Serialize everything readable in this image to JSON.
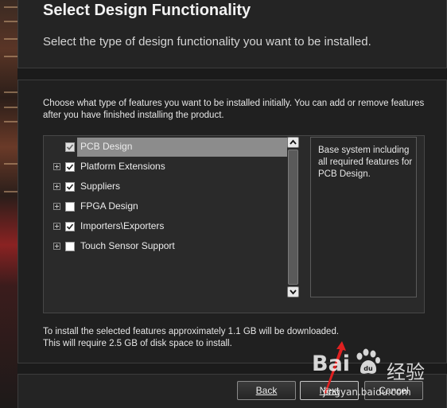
{
  "header": {
    "title": "Select Design Functionality",
    "subtitle": "Select the type of design functionality you want to be installed."
  },
  "main": {
    "intro": "Choose what type of features you want to be installed initially. You can add or remove features after you have finished installing the product.",
    "features": [
      {
        "label": "PCB Design",
        "checked": true,
        "disabled": true,
        "expandable": false,
        "selected": true
      },
      {
        "label": "Platform Extensions",
        "checked": true,
        "expandable": true
      },
      {
        "label": "Suppliers",
        "checked": true,
        "expandable": true
      },
      {
        "label": "FPGA Design",
        "checked": false,
        "expandable": true
      },
      {
        "label": "Importers\\Exporters",
        "checked": true,
        "expandable": true
      },
      {
        "label": "Touch Sensor Support",
        "checked": false,
        "expandable": true
      }
    ],
    "description": "Base system including all required features for PCB Design.",
    "download_line1": "To install the selected features approximately 1.1 GB will be downloaded.",
    "download_line2": "This will require 2.5 GB of disk space to install."
  },
  "footer": {
    "back_label": "Back",
    "next_label": "Next",
    "cancel_label": "Cancel"
  },
  "watermark": {
    "logo_text": "Bai",
    "text2": "经验",
    "url": "jingyan.baidu.com"
  },
  "icons": {
    "check": "check-icon",
    "expander": "plus-expander-icon",
    "scroll_up": "chevron-up-icon",
    "scroll_down": "chevron-down-icon"
  },
  "colors": {
    "background": "#1b1b1b",
    "panel": "#202020",
    "selected_row": "#8c8c8c",
    "annotation_arrow": "#e02020"
  }
}
